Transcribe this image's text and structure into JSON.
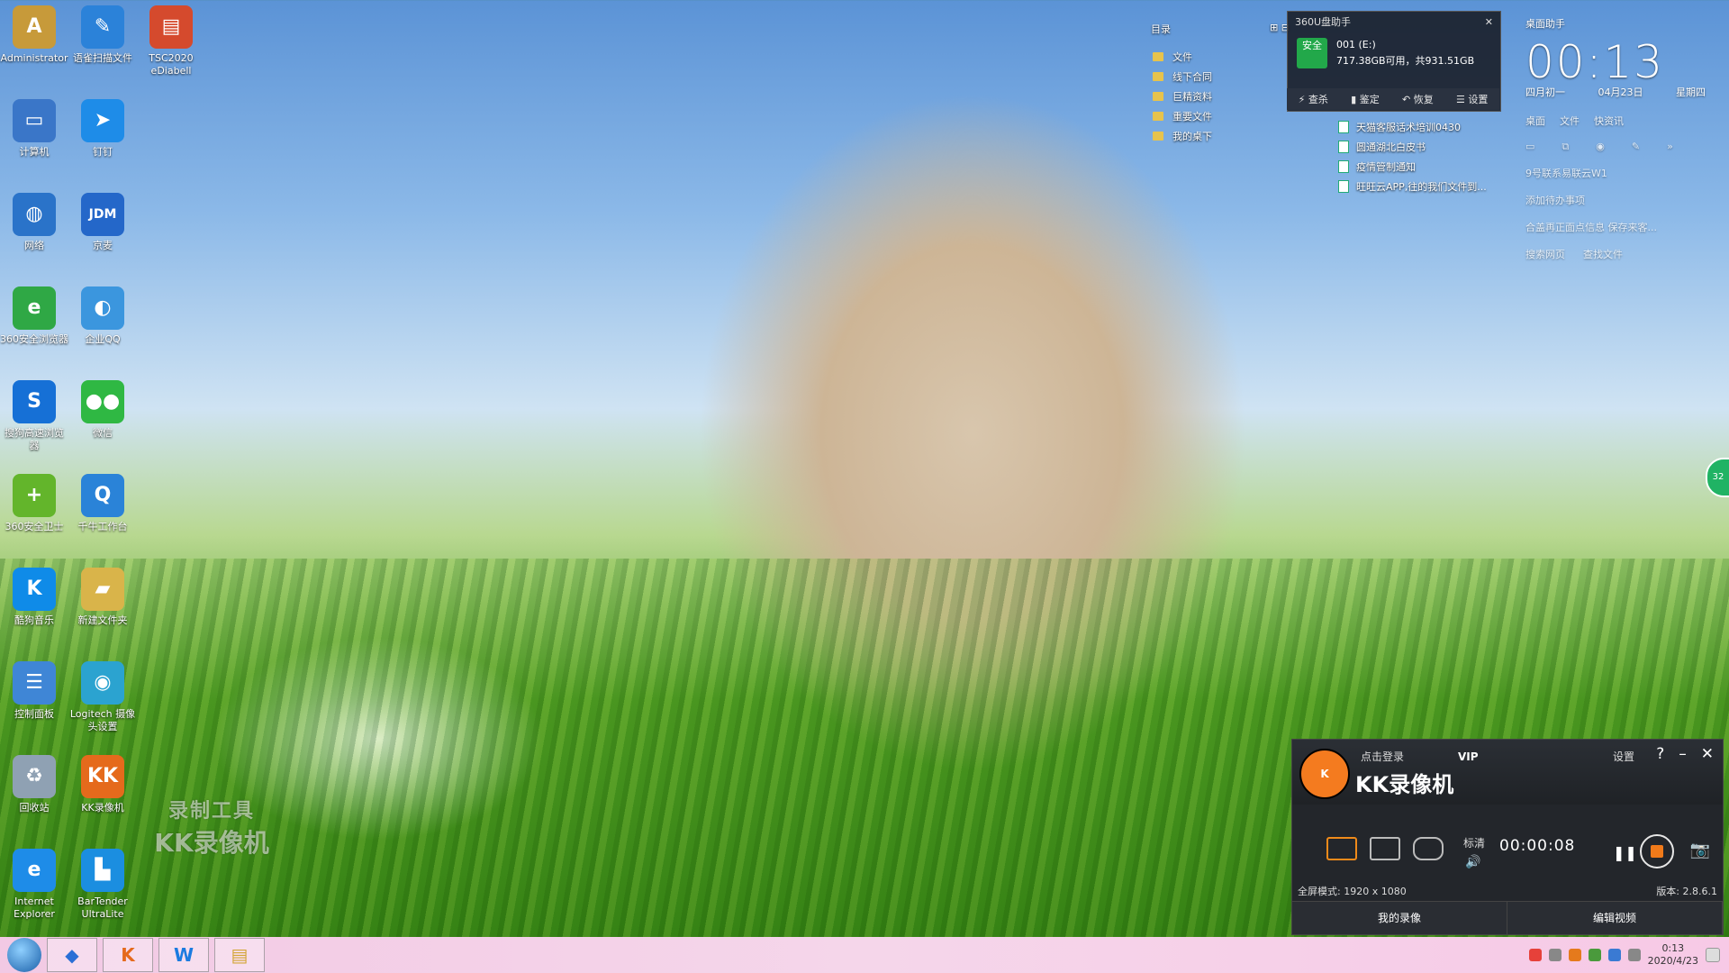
{
  "desktop_icons": [
    {
      "label": "Administrator",
      "icon": "user-folder-icon",
      "color": "#c79a3a"
    },
    {
      "label": "计算机",
      "icon": "computer-icon",
      "color": "#3a76c8"
    },
    {
      "label": "网络",
      "icon": "network-icon",
      "color": "#2a73c9"
    },
    {
      "label": "360安全浏览器",
      "icon": "browser-icon",
      "color": "#2fa845"
    },
    {
      "label": "搜狗高速浏览器",
      "icon": "sogou-icon",
      "color": "#1670d6"
    },
    {
      "label": "360安全卫士",
      "icon": "shield-icon",
      "color": "#63b52b"
    },
    {
      "label": "酷狗音乐",
      "icon": "music-icon",
      "color": "#0f8be8"
    },
    {
      "label": "控制面板",
      "icon": "control-panel-icon",
      "color": "#3f86d6"
    },
    {
      "label": "回收站",
      "icon": "recycle-bin-icon",
      "color": "#8fa1b3"
    },
    {
      "label": "Internet Explorer",
      "icon": "ie-icon",
      "color": "#1e8ce8"
    },
    {
      "label": "语雀扫描文件",
      "icon": "scan-icon",
      "color": "#2b82d9"
    },
    {
      "label": "钉钉",
      "icon": "dingtalk-icon",
      "color": "#1e8ce8"
    },
    {
      "label": "京麦",
      "icon": "jdm-icon",
      "color": "#2467c9"
    },
    {
      "label": "企业QQ",
      "icon": "qq-icon",
      "color": "#3b96de"
    },
    {
      "label": "微信",
      "icon": "wechat-icon",
      "color": "#2fb843"
    },
    {
      "label": "千牛工作台",
      "icon": "qianniu-icon",
      "color": "#2a83d8"
    },
    {
      "label": "新建文件夹",
      "icon": "folder-icon",
      "color": "#d9b44a"
    },
    {
      "label": "Logitech 摄像头设置",
      "icon": "webcam-icon",
      "color": "#2ba3d0"
    },
    {
      "label": "KK录像机",
      "icon": "kk-recorder-icon",
      "color": "#e56a1c"
    },
    {
      "label": "BarTender UltraLite",
      "icon": "bartender-icon",
      "color": "#1b8ee0"
    },
    {
      "label": "TSC2020 eDiabell",
      "icon": "archive-icon",
      "color": "#d54a2d"
    }
  ],
  "watermark": {
    "line1": "录制工具",
    "line2": "KK录像机"
  },
  "dir_panel": {
    "title": "目录",
    "items": [
      "文件",
      "线下合同",
      "巨精资料",
      "重要文件",
      "我的桌下"
    ]
  },
  "file_list": [
    "天猫客服话术培训0430",
    "圆通湖北白皮书",
    "疫情管制通知",
    "旺旺云APP,往的我们文件到..."
  ],
  "u_helper": {
    "title": "360U盘助手",
    "badge": "安全",
    "drive": "001 (E:)",
    "capacity": "717.38GB可用，共931.51GB",
    "actions": [
      "查杀",
      "鉴定",
      "恢复",
      "设置"
    ]
  },
  "assistant": {
    "title": "桌面助手",
    "time": "00:13",
    "lunar": "四月初一",
    "date": "04月23日",
    "weekday": "星期四",
    "links": [
      "桌面",
      "文件",
      "快资讯"
    ],
    "todo": "9号联系易联云W1",
    "add_todo": "添加待办事项",
    "reminder": "合盖再正面点信息 保存来客...",
    "search": "搜索网页",
    "find_file": "查找文件"
  },
  "kk": {
    "login": "点击登录",
    "vip": "VIP",
    "title": "KK录像机",
    "settings": "设置",
    "quality": "标清",
    "timer": "00:00:08",
    "mode_label": "全屏模式: 1920 x 1080",
    "version": "版本: 2.8.6.1",
    "my_recordings": "我的录像",
    "edit_video": "编辑视频"
  },
  "taskbar": {
    "clock_time": "0:13",
    "clock_date": "2020/4/23"
  },
  "dock_badge": "32",
  "colors": {
    "accent": "#f07a1a",
    "taskbar": "#f5d6ea"
  }
}
